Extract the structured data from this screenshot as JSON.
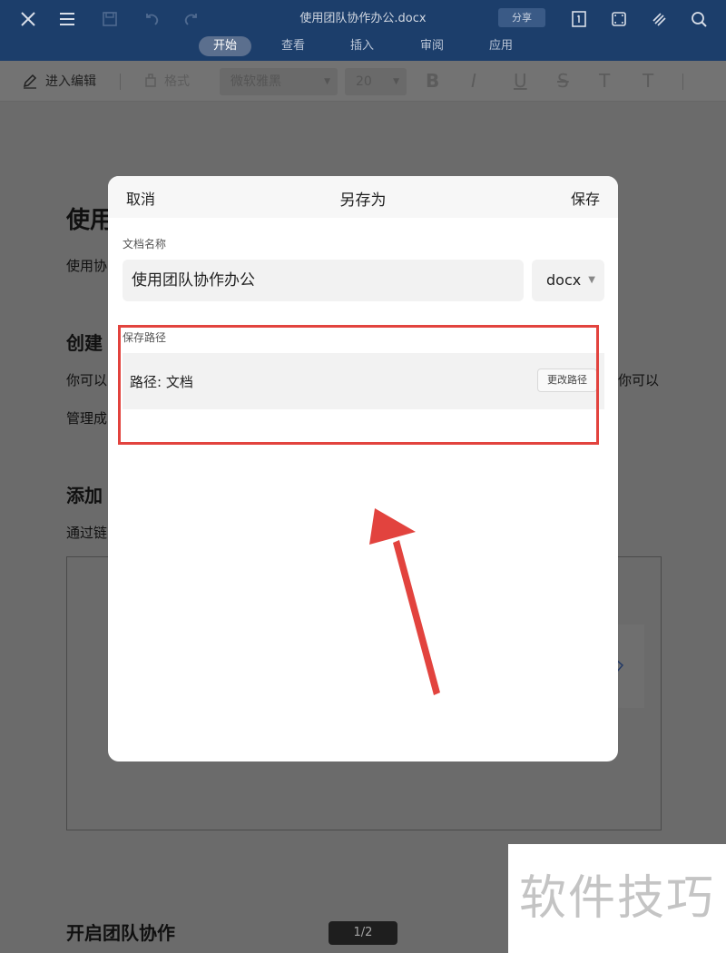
{
  "app": {
    "doc_title": "使用团队协作办公.docx",
    "share_label": "分享",
    "tabs": [
      {
        "label": "开始",
        "active": true
      },
      {
        "label": "查看",
        "active": false
      },
      {
        "label": "插入",
        "active": false
      },
      {
        "label": "审阅",
        "active": false
      },
      {
        "label": "应用",
        "active": false
      }
    ],
    "icons": [
      "close-icon",
      "menu-icon",
      "save-file-icon",
      "undo-icon",
      "redo-icon",
      "page-view-icon",
      "fullscreen-icon",
      "pen-icon",
      "search-icon"
    ],
    "accent_color": "#1c3e6b"
  },
  "toolbar": {
    "edit_label": "进入编辑",
    "format_label": "格式",
    "font_name": "微软雅黑",
    "font_size": "20",
    "style_glyphs": [
      "B",
      "I",
      "U",
      "S",
      "T",
      "T"
    ]
  },
  "document": {
    "heading1": "使用",
    "para1": "使用协",
    "heading2": "创建",
    "para2a": "你可以",
    "para2b": "你可以",
    "para2c": "管理成",
    "heading3": "添加",
    "para3": "通过链",
    "heading4": "开启团队协作",
    "page_indicator": "1/2"
  },
  "dialog": {
    "title": "另存为",
    "cancel_label": "取消",
    "save_label": "保存",
    "name_section_label": "文档名称",
    "file_name_value": "使用团队协作办公",
    "extension": "docx",
    "path_section_label": "保存路径",
    "path_text": "路径: 文档",
    "change_path_label": "更改路径",
    "highlight_color": "#e2433e"
  },
  "watermark": "软件技巧"
}
